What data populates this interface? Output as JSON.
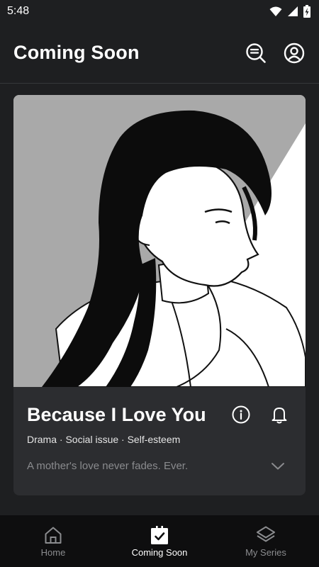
{
  "status_bar": {
    "time": "5:48"
  },
  "header": {
    "title": "Coming Soon"
  },
  "card": {
    "title": "Because I Love You",
    "genres": "Drama · Social issue · Self-esteem",
    "tagline": "A mother's love never fades. Ever."
  },
  "bottom_nav": {
    "items": [
      {
        "label": "Home",
        "icon": "home-icon",
        "active": false
      },
      {
        "label": "Coming Soon",
        "icon": "calendar-check-icon",
        "active": true
      },
      {
        "label": "My Series",
        "icon": "layers-icon",
        "active": false
      }
    ]
  },
  "colors": {
    "background": "#1e1f21",
    "card": "#2c2d30",
    "nav_background": "#0e0e0f",
    "inactive_text": "#8b8c8f",
    "tagline": "#8a8b8e"
  }
}
